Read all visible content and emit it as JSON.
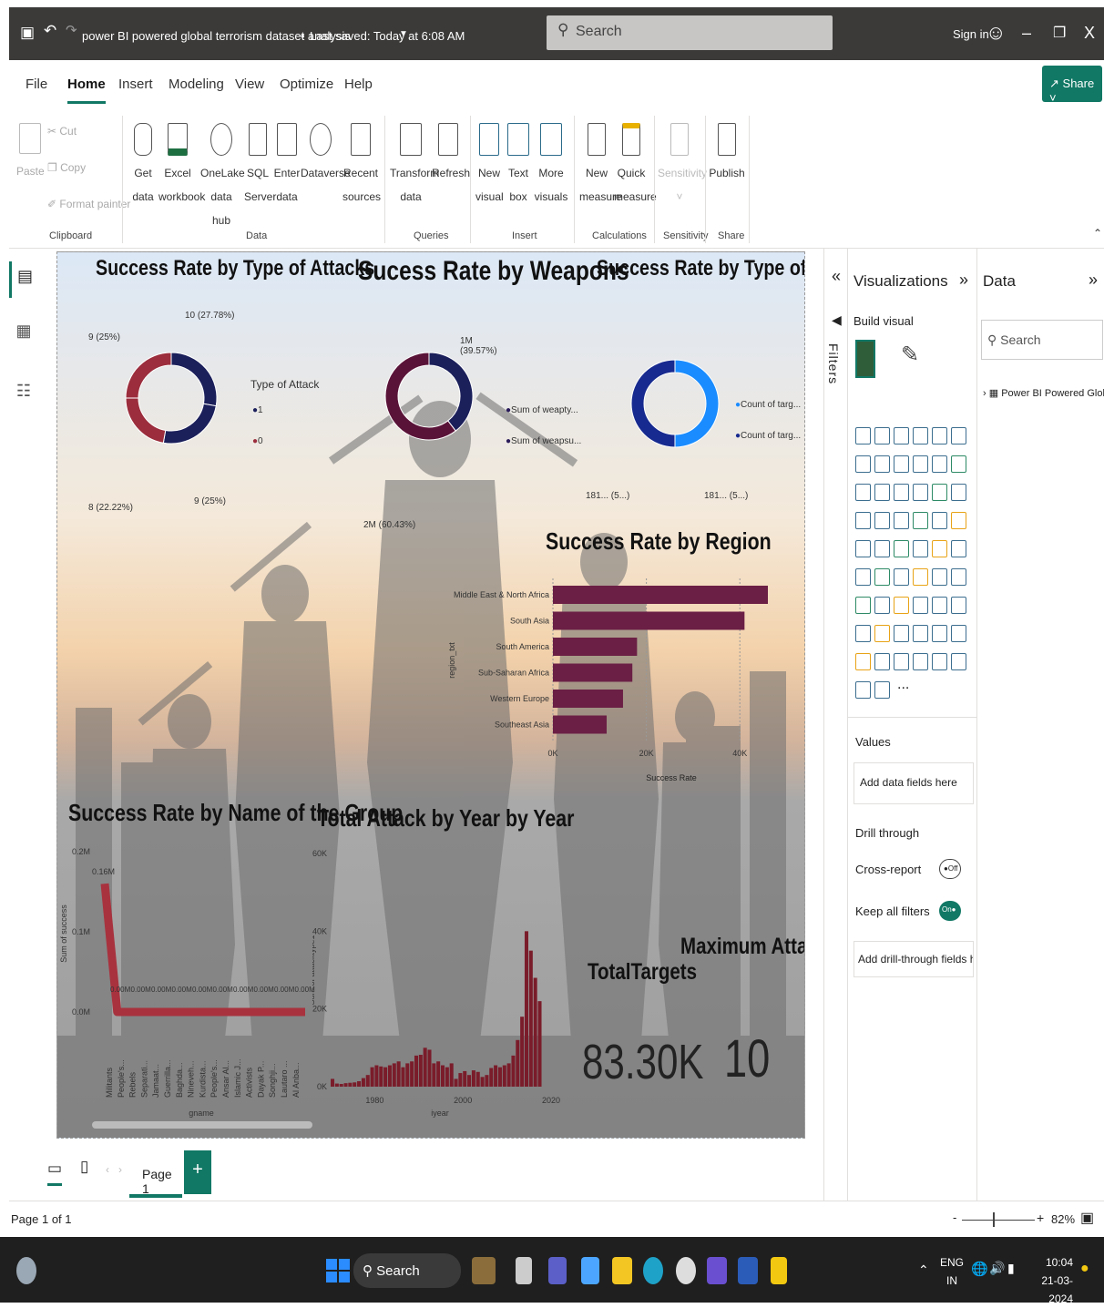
{
  "titlebar": {
    "doc_title": "power BI powered global terrorism dataset analysis",
    "saved": "Last saved: Today at 6:08 AM",
    "search": "Search",
    "signin": "Sign in"
  },
  "menu": [
    "File",
    "Home",
    "Insert",
    "Modeling",
    "View",
    "Optimize",
    "Help"
  ],
  "share": "Share",
  "ribbon": {
    "clipboard": {
      "paste": "Paste",
      "cut": "Cut",
      "copy": "Copy",
      "format_painter": "Format painter",
      "group": "Clipboard"
    },
    "data": {
      "get_data_1": "Get",
      "get_data_2": "data",
      "excel_1": "Excel",
      "excel_2": "workbook",
      "onelake_1": "OneLake",
      "onelake_2": "data hub",
      "sql_1": "SQL",
      "sql_2": "Server",
      "enter_1": "Enter",
      "enter_2": "data",
      "dataverse": "Dataverse",
      "recent_1": "Recent",
      "recent_2": "sources",
      "group": "Data"
    },
    "queries": {
      "transform_1": "Transform",
      "transform_2": "data",
      "refresh": "Refresh",
      "group": "Queries"
    },
    "insert": {
      "new_visual_1": "New",
      "new_visual_2": "visual",
      "text_box_1": "Text",
      "text_box_2": "box",
      "more_visuals_1": "More",
      "more_visuals_2": "visuals",
      "group": "Insert"
    },
    "calculations": {
      "new_measure_1": "New",
      "new_measure_2": "measure",
      "quick_measure_1": "Quick",
      "quick_measure_2": "measure",
      "group": "Calculations"
    },
    "sensitivity": {
      "label": "Sensitivity",
      "group": "Sensitivity"
    },
    "share": {
      "publish": "Publish",
      "group": "Share"
    }
  },
  "report": {
    "t1": "Success Rate by Type of Attacks",
    "t2": "Sucess Rate by Weapons",
    "t3": "Success Rate by Type of Target",
    "t4": "Success Rate by Region",
    "t5": "Success Rate by Name of the Group",
    "t6": "Total Attack by Year by Year",
    "card1_label": "TotalTargets",
    "card1_value": "83.30K",
    "card2_label": "Maximum Attacks",
    "card2_value": "10"
  },
  "chart_data": [
    {
      "type": "pie",
      "title": "Success Rate by Type of Attacks",
      "legend_title": "Type of Attack",
      "legend": [
        "1",
        "0"
      ],
      "slices": [
        {
          "label": "10 (27.78%)",
          "value": 10
        },
        {
          "label": "9 (25%)",
          "value": 9
        },
        {
          "label": "8 (22.22%)",
          "value": 8
        },
        {
          "label": "9 (25%)",
          "value": 9
        }
      ],
      "colors": [
        "#1b1f5a",
        "#9b2d3c"
      ]
    },
    {
      "type": "pie",
      "title": "Sucess Rate by Weapons",
      "legend": [
        "Sum of weapty...",
        "Sum of weapsu..."
      ],
      "slices": [
        {
          "label": "1M (39.57%)",
          "value": 39.57
        },
        {
          "label": "2M (60.43%)",
          "value": 60.43
        }
      ],
      "colors": [
        "#1b1f5a",
        "#5a1338"
      ]
    },
    {
      "type": "pie",
      "title": "Success Rate by Type of Target",
      "legend": [
        "Count of targ...",
        "Count of targ..."
      ],
      "slices": [
        {
          "label": "181... (5...)",
          "value": 50
        },
        {
          "label": "181... (5...)",
          "value": 50
        }
      ],
      "colors": [
        "#1a8cff",
        "#172a8f"
      ]
    },
    {
      "type": "bar",
      "title": "Success Rate by Region",
      "ylabel": "region_txt",
      "xlabel": "Success Rate",
      "categories": [
        "Middle East & North Africa",
        "South Asia",
        "South America",
        "Sub-Saharan Africa",
        "Western Europe",
        "Southeast Asia"
      ],
      "values": [
        46000,
        41000,
        18000,
        17000,
        15000,
        11500
      ],
      "xticks": [
        "0K",
        "20K",
        "40K"
      ],
      "xlim": [
        0,
        46000
      ],
      "color": "#6b1f45"
    },
    {
      "type": "line",
      "title": "Success Rate by Name of the Group",
      "ylabel": "Sum of success",
      "xlabel": "gname",
      "yticks": [
        "0.0M",
        "0.1M",
        "0.2M"
      ],
      "peak_label": "0.16M",
      "categories": [
        "Militants",
        "People's...",
        "Rebels",
        "Separati...",
        "Jamaat...",
        "Guerrilla...",
        "Baghda...",
        "Nineveh...",
        "Kurdista...",
        "People's...",
        "Ansar Al...",
        "Islamic J...",
        "Activists",
        "Dayak P...",
        "Songhji...",
        "Lautaro ...",
        "Al Anba..."
      ],
      "values": [
        0.16,
        0,
        0,
        0,
        0,
        0,
        0,
        0,
        0,
        0,
        0,
        0,
        0,
        0,
        0,
        0,
        0
      ],
      "data_labels": [
        "0.00M",
        "0.00M",
        "0.00M",
        "0.00M",
        "0.00M",
        "0.00M",
        "0.00M",
        "0.00M",
        "0.00M",
        "0.00M"
      ],
      "color": "#a8323e"
    },
    {
      "type": "bar",
      "title": "Total Attack by Year by Year",
      "ylabel": "Sum of attacktype1",
      "xlabel": "iyear",
      "yticks": [
        "0K",
        "20K",
        "40K",
        "60K"
      ],
      "xticks": [
        "1980",
        "2000",
        "2020"
      ],
      "x": [
        1970,
        1971,
        1972,
        1973,
        1974,
        1975,
        1976,
        1977,
        1978,
        1979,
        1980,
        1981,
        1982,
        1983,
        1984,
        1985,
        1986,
        1987,
        1988,
        1989,
        1990,
        1991,
        1992,
        1993,
        1994,
        1995,
        1996,
        1997,
        1998,
        1999,
        2000,
        2001,
        2002,
        2003,
        2004,
        2005,
        2006,
        2007,
        2008,
        2009,
        2010,
        2011,
        2012,
        2013,
        2014,
        2015,
        2016,
        2017
      ],
      "values": [
        2000,
        800,
        700,
        900,
        1000,
        1100,
        1400,
        2200,
        3000,
        5000,
        5500,
        5200,
        5000,
        5500,
        6000,
        6500,
        5000,
        6000,
        6500,
        8000,
        8200,
        10000,
        9500,
        6000,
        6500,
        5500,
        5000,
        6000,
        2000,
        3500,
        4000,
        3000,
        4200,
        3800,
        2500,
        3000,
        4800,
        5500,
        5000,
        5500,
        6000,
        8000,
        12000,
        18000,
        40000,
        35000,
        28000,
        22000
      ],
      "color": "#7a1c2a"
    }
  ],
  "filters_label": "Filters",
  "viz": {
    "title": "Visualizations",
    "build": "Build visual",
    "values": "Values",
    "add_fields": "Add data fields here",
    "drill": "Drill through",
    "cross": "Cross-report",
    "cross_state": "Off",
    "keep": "Keep all filters",
    "keep_state": "On",
    "add_drill": "Add drill-through fields here",
    "more": "..."
  },
  "data": {
    "title": "Data",
    "search": "Search",
    "table": "Power BI Powered Glob..."
  },
  "pages": {
    "tab": "Page 1",
    "status": "Page 1 of 1",
    "zoom": "82%"
  },
  "taskbar": {
    "search": "Search",
    "lang1": "ENG",
    "lang2": "IN",
    "time": "10:04",
    "date": "21-03-2024"
  }
}
